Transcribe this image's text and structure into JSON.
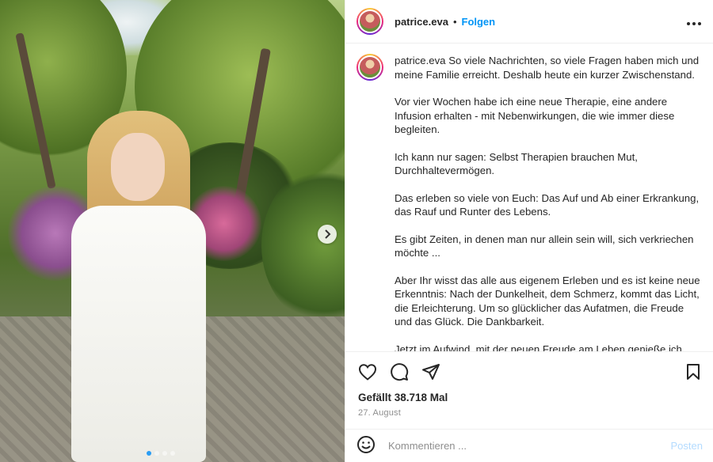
{
  "post": {
    "username": "patrice.eva",
    "follow_label": "Folgen",
    "separator": "•",
    "more_icon": "more-horizontal-icon",
    "image_description": "woman in white dress in garden",
    "carousel": {
      "slide_count": 4,
      "active_index": 0
    }
  },
  "caption": {
    "username": "patrice.eva",
    "paragraphs": [
      "So viele Nachrichten, so viele Fragen haben mich und meine Familie erreicht. Deshalb heute ein kurzer Zwischenstand.",
      "Vor vier Wochen habe ich eine neue Therapie, eine andere Infusion erhalten - mit Nebenwirkungen, die wie immer diese begleiten.",
      "Ich kann nur sagen: Selbst Therapien brauchen Mut, Durchhaltevermögen.",
      "Das erleben so viele von Euch: Das Auf und Ab einer Erkrankung, das Rauf und Runter des Lebens.",
      "Es gibt Zeiten, in denen man nur allein sein will, sich verkriechen möchte ...",
      "Aber Ihr wisst das alle aus eigenem Erleben und es ist keine neue Erkenntnis: Nach der Dunkelheit, dem Schmerz, kommt das Licht, die Erleichterung. Um so glücklicher das Aufatmen, die Freude und das Glück. Die Dankbarkeit.",
      "Jetzt im Aufwind, mit der neuen Freude am Leben genieße ich"
    ]
  },
  "actions": {
    "likes_text": "Gefällt 38.718 Mal",
    "date_text": "27. August",
    "icons": [
      "heart-icon",
      "comment-icon",
      "share-icon",
      "bookmark-icon"
    ]
  },
  "comment": {
    "placeholder": "Kommentieren ...",
    "post_label": "Posten",
    "emoji_icon": "emoji-icon"
  },
  "colors": {
    "follow_blue": "#0095f6",
    "post_disabled": "#b3dbff",
    "muted_text": "#8e8e8e",
    "border": "#efefef"
  }
}
